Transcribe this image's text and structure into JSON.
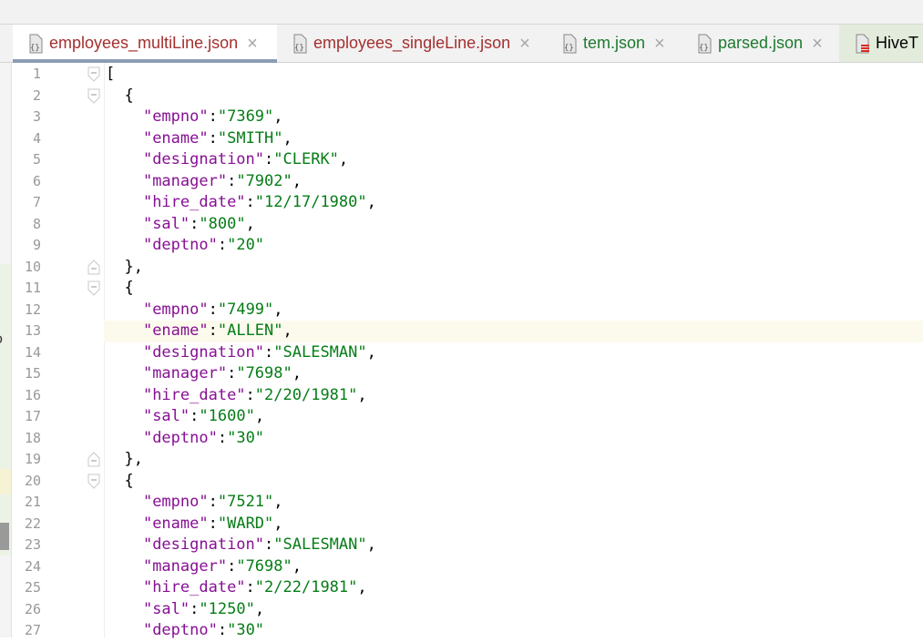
{
  "tabs": [
    {
      "label": "employees_multiLine.json",
      "close": "×",
      "active": true,
      "color": "#a3302e"
    },
    {
      "label": "employees_singleLine.json",
      "close": "×",
      "active": false,
      "color": "#a3302e"
    },
    {
      "label": "tem.json",
      "close": "×",
      "active": false,
      "color": "#1d7a2f"
    },
    {
      "label": "parsed.json",
      "close": "×",
      "active": false,
      "color": "#1d7a2f"
    },
    {
      "label": "HiveT",
      "active": false
    }
  ],
  "left_panel": {
    "clipped_text": "o"
  },
  "editor": {
    "current_line": 13,
    "line_numbers": [
      "1",
      "2",
      "3",
      "4",
      "5",
      "6",
      "7",
      "8",
      "9",
      "10",
      "11",
      "12",
      "13",
      "14",
      "15",
      "16",
      "17",
      "18",
      "19",
      "20",
      "21",
      "22",
      "23",
      "24",
      "25",
      "26",
      "27"
    ],
    "records": [
      {
        "open": "{",
        "close": "},",
        "fields": [
          {
            "key": "\"empno\"",
            "sep": ":",
            "value": "\"7369\"",
            "end": ","
          },
          {
            "key": "\"ename\"",
            "sep": ":",
            "value": "\"SMITH\"",
            "end": ","
          },
          {
            "key": "\"designation\"",
            "sep": ":",
            "value": "\"CLERK\"",
            "end": ","
          },
          {
            "key": "\"manager\"",
            "sep": ":",
            "value": "\"7902\"",
            "end": ","
          },
          {
            "key": "\"hire_date\"",
            "sep": ":",
            "value": "\"12/17/1980\"",
            "end": ","
          },
          {
            "key": "\"sal\"",
            "sep": ":",
            "value": "\"800\"",
            "end": ","
          },
          {
            "key": "\"deptno\"",
            "sep": ":",
            "value": "\"20\"",
            "end": ""
          }
        ]
      },
      {
        "open": "{",
        "close": "},",
        "fields": [
          {
            "key": "\"empno\"",
            "sep": ":",
            "value": "\"7499\"",
            "end": ","
          },
          {
            "key": "\"ename\"",
            "sep": ":",
            "value": "\"ALLEN\"",
            "end": ","
          },
          {
            "key": "\"designation\"",
            "sep": ":",
            "value": "\"SALESMAN\"",
            "end": ","
          },
          {
            "key": "\"manager\"",
            "sep": ":",
            "value": "\"7698\"",
            "end": ","
          },
          {
            "key": "\"hire_date\"",
            "sep": ":",
            "value": "\"2/20/1981\"",
            "end": ","
          },
          {
            "key": "\"sal\"",
            "sep": ":",
            "value": "\"1600\"",
            "end": ","
          },
          {
            "key": "\"deptno\"",
            "sep": ":",
            "value": "\"30\"",
            "end": ""
          }
        ]
      },
      {
        "open": "{",
        "close": "",
        "fields": [
          {
            "key": "\"empno\"",
            "sep": ":",
            "value": "\"7521\"",
            "end": ","
          },
          {
            "key": "\"ename\"",
            "sep": ":",
            "value": "\"WARD\"",
            "end": ","
          },
          {
            "key": "\"designation\"",
            "sep": ":",
            "value": "\"SALESMAN\"",
            "end": ","
          },
          {
            "key": "\"manager\"",
            "sep": ":",
            "value": "\"7698\"",
            "end": ","
          },
          {
            "key": "\"hire_date\"",
            "sep": ":",
            "value": "\"2/22/1981\"",
            "end": ","
          },
          {
            "key": "\"sal\"",
            "sep": ":",
            "value": "\"1250\"",
            "end": ","
          },
          {
            "key": "\"deptno\"",
            "sep": ":",
            "value": "\"30\"",
            "end": ""
          }
        ]
      }
    ],
    "array_open": "["
  },
  "colors": {
    "key": "#871094",
    "value": "#067d17",
    "line_number": "#999999",
    "current_line_bg": "#fcfaed"
  }
}
